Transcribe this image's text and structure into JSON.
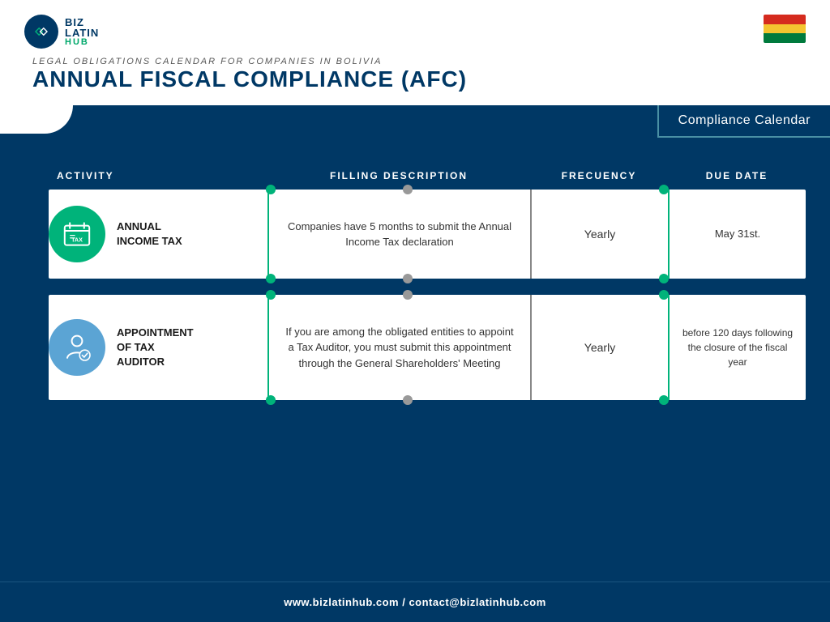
{
  "header": {
    "logo_biz": "BIZ",
    "logo_latin": "LATIN",
    "logo_hub": "HUB",
    "subtitle": "Legal Obligations Calendar for Companies in Bolivia",
    "main_title": "Annual Fiscal Compliance (AFC)",
    "compliance_badge": "Compliance Calendar"
  },
  "table": {
    "columns": {
      "activity": "ACTIVITY",
      "filling": "FILLING DESCRIPTION",
      "frequency": "FRECUENCY",
      "due_date": "DUE DATE"
    },
    "rows": [
      {
        "id": "annual-income-tax",
        "icon_type": "tax",
        "icon_color": "green",
        "activity": "ANNUAL\nINCOME TAX",
        "description": "Companies have 5 months to submit the Annual Income Tax declaration",
        "frequency": "Yearly",
        "due_date": "May 31st."
      },
      {
        "id": "appointment-tax-auditor",
        "icon_type": "auditor",
        "icon_color": "blue",
        "activity": "APPOINTMENT\nOF TAX\nAUDITOR",
        "description": "If you are among the obligated entities to appoint a Tax Auditor, you must submit this appointment through the General Shareholders' Meeting",
        "frequency": "Yearly",
        "due_date": "before 120 days following the closure of the fiscal year"
      }
    ]
  },
  "footer": {
    "text": "www.bizlatinhub.com / contact@bizlatinhub.com"
  }
}
